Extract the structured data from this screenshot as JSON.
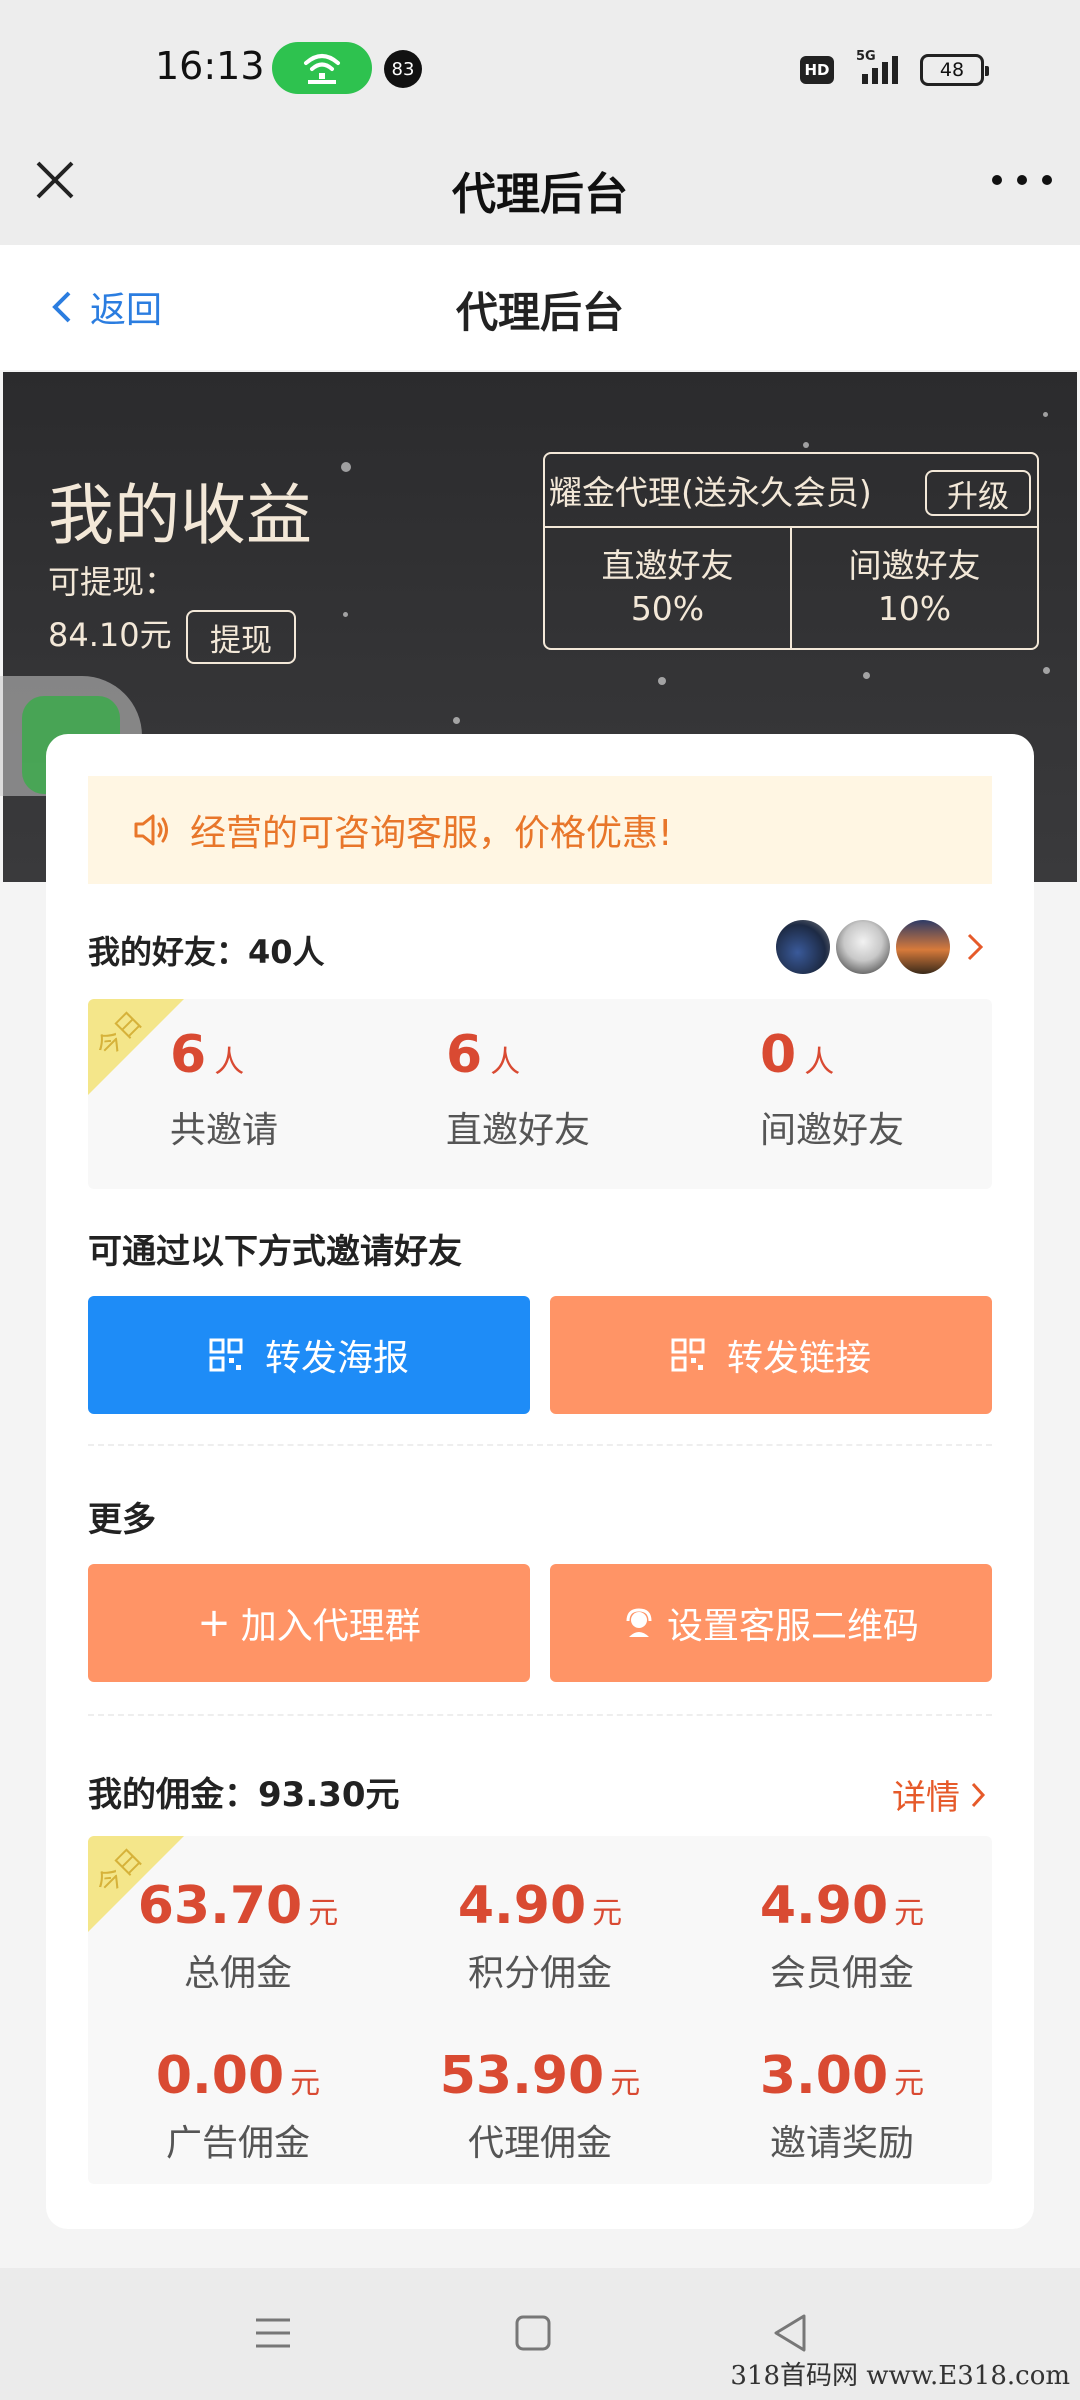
{
  "status_bar": {
    "time": "16:13",
    "notification_count": "83",
    "hd_label": "HD",
    "network": "5G",
    "battery": "48"
  },
  "webview": {
    "title": "代理后台"
  },
  "page_nav": {
    "back_label": "返回",
    "title": "代理后台",
    "link_color": "#2b7de0"
  },
  "earnings": {
    "title": "我的收益",
    "withdrawable_label": "可提现：",
    "withdrawable_amount": "84.10元",
    "withdraw_button": "提现",
    "agent_level": "耀金代理(送永久会员)",
    "upgrade_button": "升级",
    "direct_invite_label": "直邀好友",
    "direct_invite_rate": "50%",
    "indirect_invite_label": "间邀好友",
    "indirect_invite_rate": "10%"
  },
  "notice": {
    "text": "经营的可咨询客服，价格优惠!",
    "icon": "speaker-icon"
  },
  "friends": {
    "label": "我的好友：",
    "count": "40人",
    "today_tag": "今日",
    "stats": [
      {
        "value": "6",
        "unit": "人",
        "label": "共邀请"
      },
      {
        "value": "6",
        "unit": "人",
        "label": "直邀好友"
      },
      {
        "value": "0",
        "unit": "人",
        "label": "间邀好友"
      }
    ]
  },
  "invite": {
    "heading": "可通过以下方式邀请好友",
    "poster_button": "转发海报",
    "link_button": "转发链接"
  },
  "more": {
    "heading": "更多",
    "join_group_button": "加入代理群",
    "join_group_prefix": "+",
    "set_qr_button": "设置客服二维码"
  },
  "commission": {
    "label": "我的佣金：",
    "amount": "93.30元",
    "detail_link": "详情",
    "today_tag": "今日",
    "items": [
      {
        "value": "63.70",
        "unit": "元",
        "label": "总佣金"
      },
      {
        "value": "4.90",
        "unit": "元",
        "label": "积分佣金"
      },
      {
        "value": "4.90",
        "unit": "元",
        "label": "会员佣金"
      },
      {
        "value": "0.00",
        "unit": "元",
        "label": "广告佣金"
      },
      {
        "value": "53.90",
        "unit": "元",
        "label": "代理佣金"
      },
      {
        "value": "3.00",
        "unit": "元",
        "label": "邀请奖励"
      }
    ]
  },
  "watermark": "318首码网 www.E318.com",
  "colors": {
    "accent_red": "#d94a32",
    "primary_blue": "#1e8cf7",
    "orange": "#ff9466",
    "notice_text": "#e8762a"
  }
}
